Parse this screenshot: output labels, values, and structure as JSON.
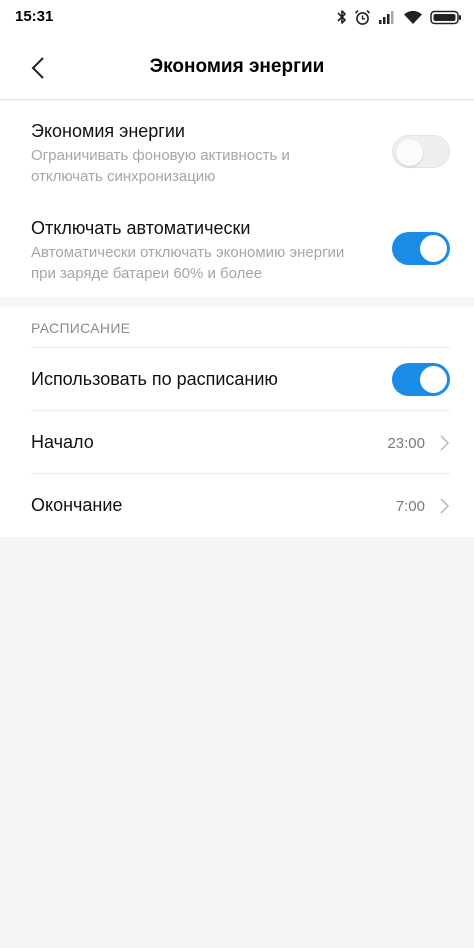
{
  "status_bar": {
    "time": "15:31",
    "icons": [
      "bluetooth-icon",
      "alarm-icon",
      "signal-icon",
      "wifi-icon",
      "battery-icon"
    ]
  },
  "header": {
    "title": "Экономия энергии",
    "back_icon": "chevron-left-icon"
  },
  "power_saving": {
    "label": "Экономия энергии",
    "description": "Ограничивать фоновую активность и отключать синхронизацию",
    "enabled": false
  },
  "auto_off": {
    "label": "Отключать автоматически",
    "description": "Автоматически отключать экономию энергии при заряде батареи 60% и более",
    "enabled": true
  },
  "schedule": {
    "header": "РАСПИСАНИЕ",
    "use_schedule": {
      "label": "Использовать по расписанию",
      "enabled": true
    },
    "start": {
      "label": "Начало",
      "value": "23:00"
    },
    "end": {
      "label": "Окончание",
      "value": "7:00"
    }
  },
  "colors": {
    "accent": "#1a8ce8",
    "background": "#f5f5f5",
    "secondary_text": "#a6a6a6"
  }
}
